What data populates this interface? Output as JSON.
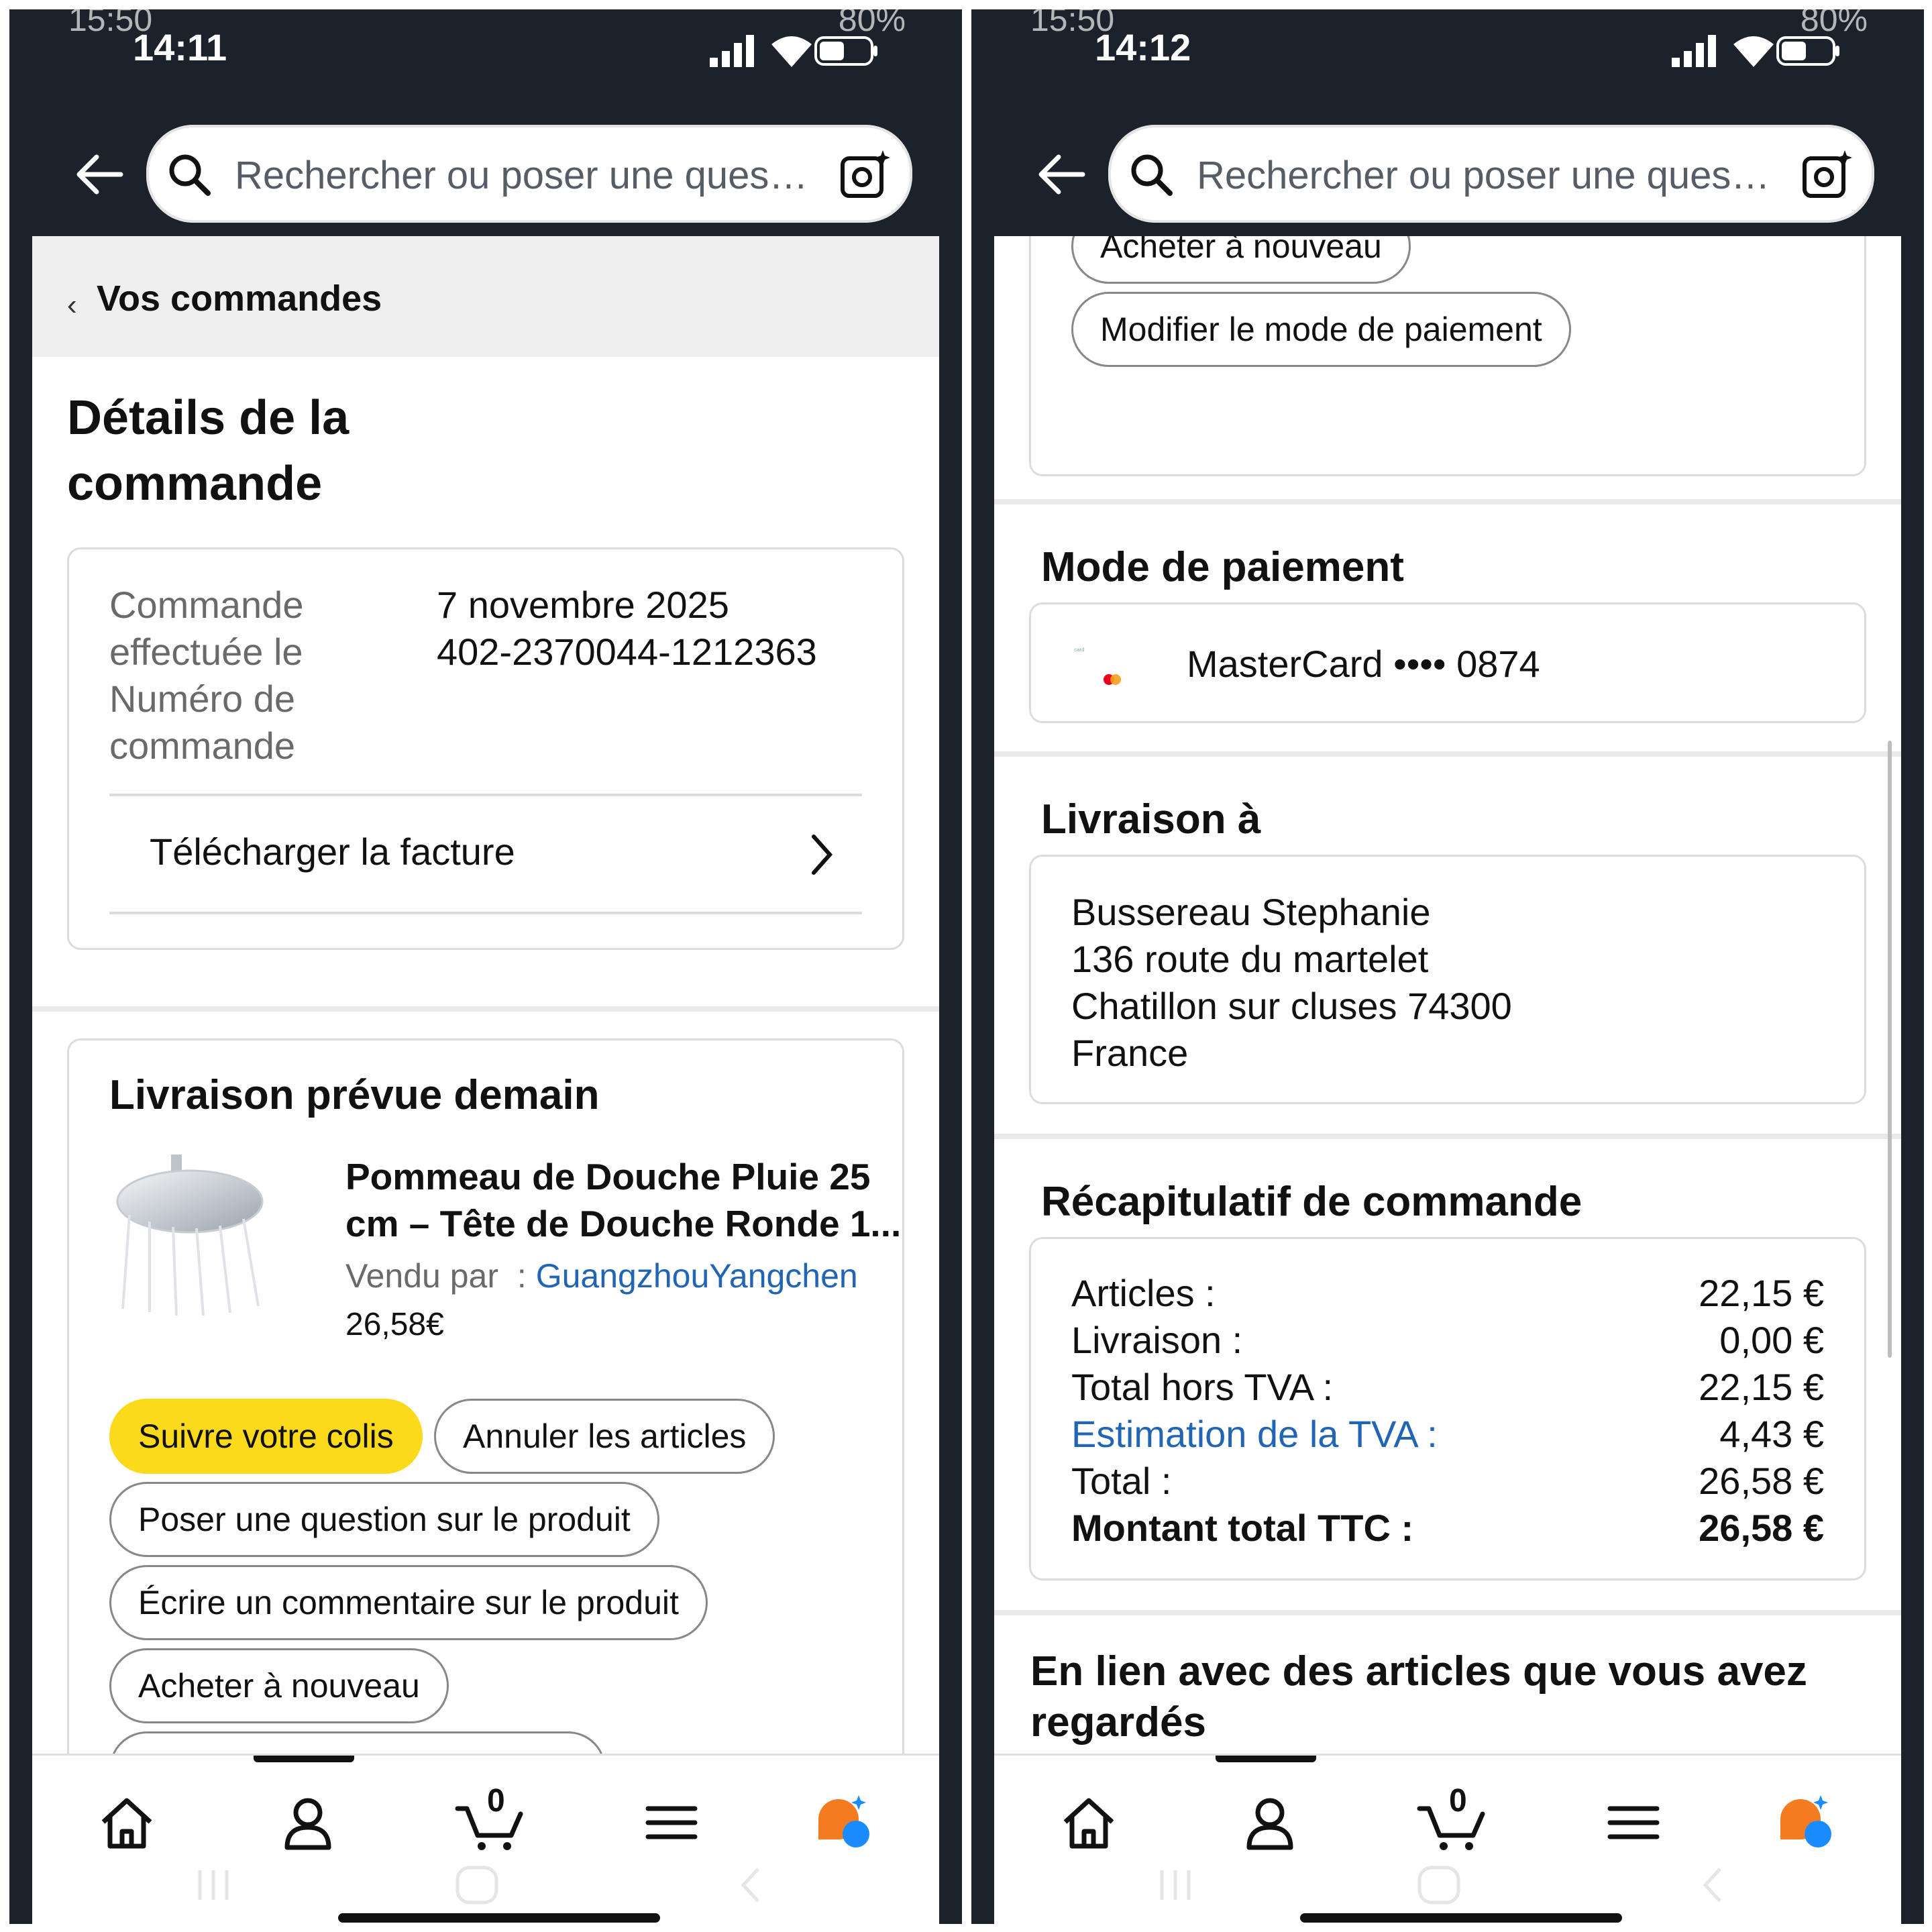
{
  "left": {
    "status": {
      "ghost_time": "15:50",
      "time": "14:11",
      "ghost_battery": "80%"
    },
    "search_placeholder": "Rechercher ou poser une ques…",
    "breadcrumb": "Vos commandes",
    "page_title": "Détails de la commande",
    "order_info": {
      "date_label": "Commande effectuée le",
      "date_value": "7 novembre 2025",
      "number_label": "Numéro de commande",
      "number_value": "402-2370044-1212363",
      "invoice_link": "Télécharger la facture"
    },
    "delivery": {
      "title": "Livraison prévue demain",
      "product_title_line1": "Pommeau de Douche Pluie 25",
      "product_title_line2": "cm – Tête de Douche Ronde 1...",
      "sold_by_label": "Vendu par",
      "seller_colon": ":",
      "seller_name": "GuangzhouYangchen",
      "price": "26,58€",
      "buttons": [
        "Suivre votre colis",
        "Annuler les articles",
        "Poser une question sur le produit",
        "Écrire un commentaire sur le produit",
        "Acheter à nouveau"
      ]
    },
    "nav": {
      "cart_count": "0"
    }
  },
  "right": {
    "status": {
      "ghost_time": "15:50",
      "time": "14:12",
      "ghost_battery": "80%"
    },
    "search_placeholder": "Rechercher ou poser une ques…",
    "action_buttons": [
      "Acheter à nouveau",
      "Modifier le mode de paiement"
    ],
    "payment": {
      "title": "Mode de paiement",
      "card_text": "MasterCard •••• 0874"
    },
    "shipping": {
      "title": "Livraison à",
      "lines": [
        "Bussereau Stephanie",
        "136 route du martelet",
        "Chatillon sur cluses 74300",
        "France"
      ]
    },
    "summary": {
      "title": "Récapitulatif de commande",
      "rows": [
        {
          "label": "Articles :",
          "value": "22,15 €"
        },
        {
          "label": "Livraison :",
          "value": "0,00 €"
        },
        {
          "label": "Total hors TVA :",
          "value": "22,15 €"
        },
        {
          "label": "Estimation de la TVA :",
          "value": "4,43 €"
        },
        {
          "label": "Total :",
          "value": "26,58 €"
        },
        {
          "label": "Montant total TTC :",
          "value": "26,58 €"
        }
      ]
    },
    "related_title": "En lien avec des articles que vous avez regardés",
    "nav": {
      "cart_count": "0"
    }
  },
  "colors": {
    "header": "#1b222c",
    "accent_yellow": "#fbd91b",
    "link_blue": "#2165b4",
    "assistant_orange": "#f47b20",
    "assistant_blue": "#1a8cff"
  }
}
